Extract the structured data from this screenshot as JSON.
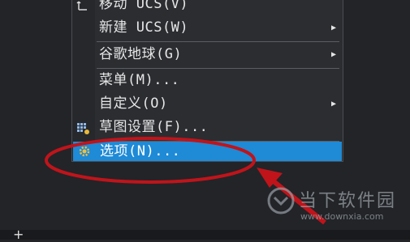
{
  "menu": {
    "items": [
      {
        "label": "移动 UCS(V)",
        "has_submenu": false
      },
      {
        "label": "新建 UCS(W)",
        "has_submenu": true
      },
      {
        "label": "谷歌地球(G)",
        "has_submenu": true
      },
      {
        "label": "菜单(M)...",
        "has_submenu": false
      },
      {
        "label": "自定义(O)",
        "has_submenu": true
      },
      {
        "label": "草图设置(F)...",
        "has_submenu": false
      },
      {
        "label": "选项(N)...",
        "has_submenu": false,
        "selected": true
      }
    ],
    "submenu_arrow": "▶",
    "selected_color": "#1f8ad6"
  },
  "annotation": {
    "ellipse_color": "#c0141a",
    "arrow_color": "#c0141a"
  },
  "statusbar": {
    "plus": "+"
  },
  "watermark": {
    "name": "当下软件园",
    "url": "www.downxia.com"
  }
}
